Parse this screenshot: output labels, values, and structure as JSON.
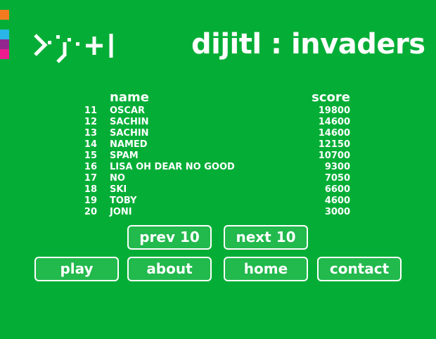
{
  "logo": {
    "text": "dijitl",
    "icon": "dijitl-logo-icon"
  },
  "title": "dijitl : invaders",
  "swatch_colors": [
    "#f47a20",
    "#29b5e8",
    "#93278f",
    "#ec1c8e"
  ],
  "leaderboard": {
    "name_header": "name",
    "score_header": "score",
    "rows": [
      {
        "rank": "11",
        "name": "OSCAR",
        "score": "19800"
      },
      {
        "rank": "12",
        "name": "SACHIN",
        "score": "14600"
      },
      {
        "rank": "13",
        "name": "SACHIN",
        "score": "14600"
      },
      {
        "rank": "14",
        "name": "NAMED",
        "score": "12150"
      },
      {
        "rank": "15",
        "name": "SPAM",
        "score": "10700"
      },
      {
        "rank": "16",
        "name": "LISA OH DEAR NO GOOD",
        "score": "9300"
      },
      {
        "rank": "17",
        "name": "NO",
        "score": "7050"
      },
      {
        "rank": "18",
        "name": "SKI",
        "score": "6600"
      },
      {
        "rank": "19",
        "name": "TOBY",
        "score": "4600"
      },
      {
        "rank": "20",
        "name": "JONI",
        "score": "3000"
      }
    ]
  },
  "pagination": {
    "prev_label": "prev 10",
    "next_label": "next 10"
  },
  "nav": {
    "play_label": "play",
    "about_label": "about",
    "home_label": "home",
    "contact_label": "contact"
  },
  "colors": {
    "background": "#04ae36",
    "button_fill": "#22b94d",
    "text": "#ffffff"
  }
}
